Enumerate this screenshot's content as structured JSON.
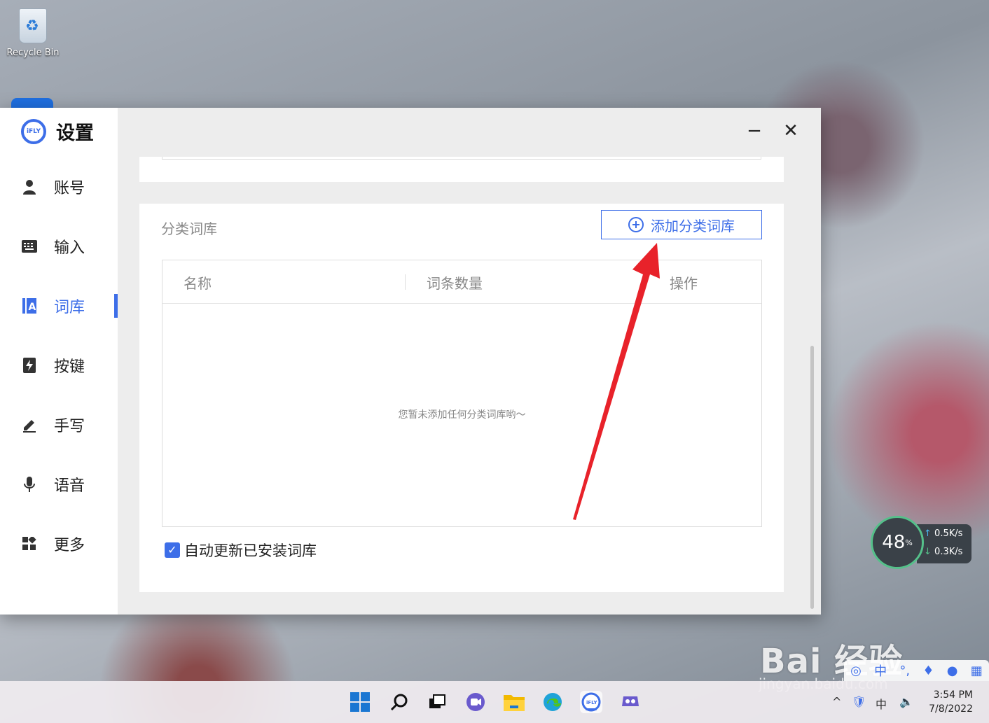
{
  "desktop": {
    "recycle_bin_label": "Recycle Bin"
  },
  "window": {
    "title": "设置",
    "logo_text": "iFLY",
    "minimize_glyph": "−",
    "close_glyph": "✕"
  },
  "sidebar": {
    "items": [
      {
        "label": "账号",
        "icon": "user-icon",
        "active": false
      },
      {
        "label": "输入",
        "icon": "keyboard-icon",
        "active": false
      },
      {
        "label": "词库",
        "icon": "lexicon-icon",
        "active": true
      },
      {
        "label": "按键",
        "icon": "key-bolt-icon",
        "active": false
      },
      {
        "label": "手写",
        "icon": "pen-icon",
        "active": false
      },
      {
        "label": "语音",
        "icon": "microphone-icon",
        "active": false
      },
      {
        "label": "更多",
        "icon": "more-grid-icon",
        "active": false
      }
    ]
  },
  "category_lexicon": {
    "section_title": "分类词库",
    "add_button_label": "添加分类词库",
    "columns": [
      "名称",
      "词条数量",
      "操作"
    ],
    "empty_message": "您暂未添加任何分类词库哟～",
    "auto_update_label": "自动更新已安装词库",
    "auto_update_checked": true
  },
  "speed_widget": {
    "percent": "48",
    "percent_unit": "%",
    "upload": "0.5K/s",
    "download": "0.3K/s"
  },
  "watermark": {
    "brand": "Bai 经验",
    "url": "jingyan.baidu.com"
  },
  "taskbar": {
    "clock_time": "3:54 PM",
    "clock_date": "7/8/2022",
    "icons": [
      "start-icon",
      "search-icon",
      "task-view-icon",
      "chat-icon",
      "file-explorer-icon",
      "edge-icon",
      "ifly-icon",
      "game-app-icon"
    ]
  },
  "colors": {
    "accent": "#3d6ee8",
    "annotation_arrow": "#e8222a"
  }
}
